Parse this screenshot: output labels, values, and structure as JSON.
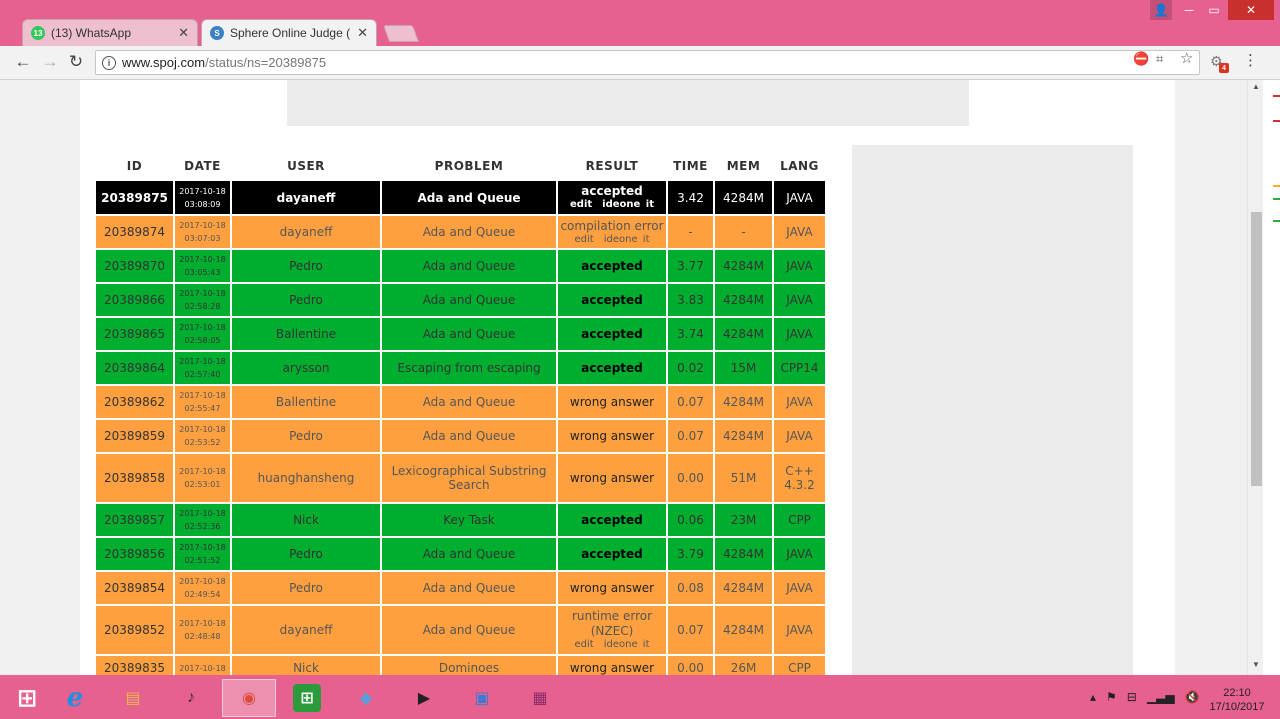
{
  "browser": {
    "tabs": [
      {
        "title": "(13) WhatsApp",
        "favicon": "whatsapp-icon",
        "favicon_text": "13",
        "favicon_color": "#34c759",
        "active": false
      },
      {
        "title": "Sphere Online Judge (SP",
        "favicon": "spoj-icon",
        "favicon_text": "S",
        "favicon_color": "#3a82c4",
        "active": true
      }
    ],
    "url_host": "www.spoj.com",
    "url_path": "/status/ns=20389875",
    "extension_badge": "4"
  },
  "table": {
    "headers": {
      "id": "ID",
      "date": "DATE",
      "user": "USER",
      "problem": "PROBLEM",
      "result": "RESULT",
      "time": "TIME",
      "mem": "MEM",
      "lang": "LANG"
    },
    "link_edit": "edit",
    "link_ideone": "ideone it",
    "rows": [
      {
        "id": "20389875",
        "date": "2017-10-18",
        "time_of_day": "03:08:09",
        "user": "dayaneff",
        "problem": "Ada and Queue",
        "result": "accepted",
        "links": true,
        "time": "3.42",
        "mem": "4284M",
        "lang": "JAVA",
        "color": "black"
      },
      {
        "id": "20389874",
        "date": "2017-10-18",
        "time_of_day": "03:07:03",
        "user": "dayaneff",
        "problem": "Ada and Queue",
        "result": "compilation error",
        "links": true,
        "time": "-",
        "mem": "-",
        "lang": "JAVA",
        "color": "orange"
      },
      {
        "id": "20389870",
        "date": "2017-10-18",
        "time_of_day": "03:05:43",
        "user": "Pedro",
        "problem": "Ada and Queue",
        "result": "accepted",
        "links": false,
        "time": "3.77",
        "mem": "4284M",
        "lang": "JAVA",
        "color": "green"
      },
      {
        "id": "20389866",
        "date": "2017-10-18",
        "time_of_day": "02:58:28",
        "user": "Pedro",
        "problem": "Ada and Queue",
        "result": "accepted",
        "links": false,
        "time": "3.83",
        "mem": "4284M",
        "lang": "JAVA",
        "color": "green"
      },
      {
        "id": "20389865",
        "date": "2017-10-18",
        "time_of_day": "02:58:05",
        "user": "Ballentine",
        "problem": "Ada and Queue",
        "result": "accepted",
        "links": false,
        "time": "3.74",
        "mem": "4284M",
        "lang": "JAVA",
        "color": "green"
      },
      {
        "id": "20389864",
        "date": "2017-10-18",
        "time_of_day": "02:57:40",
        "user": "arysson",
        "problem": "Escaping from escaping",
        "result": "accepted",
        "links": false,
        "time": "0.02",
        "mem": "15M",
        "lang": "CPP14",
        "color": "green"
      },
      {
        "id": "20389862",
        "date": "2017-10-18",
        "time_of_day": "02:55:47",
        "user": "Ballentine",
        "problem": "Ada and Queue",
        "result": "wrong answer",
        "links": false,
        "time": "0.07",
        "mem": "4284M",
        "lang": "JAVA",
        "color": "orange"
      },
      {
        "id": "20389859",
        "date": "2017-10-18",
        "time_of_day": "02:53:52",
        "user": "Pedro",
        "problem": "Ada and Queue",
        "result": "wrong answer",
        "links": false,
        "time": "0.07",
        "mem": "4284M",
        "lang": "JAVA",
        "color": "orange"
      },
      {
        "id": "20389858",
        "date": "2017-10-18",
        "time_of_day": "02:53:01",
        "user": "huanghansheng",
        "problem": "Lexicographical Substring Search",
        "result": "wrong answer",
        "links": false,
        "time": "0.00",
        "mem": "51M",
        "lang": "C++ 4.3.2",
        "color": "orange"
      },
      {
        "id": "20389857",
        "date": "2017-10-18",
        "time_of_day": "02:52:36",
        "user": "Nick",
        "problem": "Key Task",
        "result": "accepted",
        "links": false,
        "time": "0.06",
        "mem": "23M",
        "lang": "CPP",
        "color": "green"
      },
      {
        "id": "20389856",
        "date": "2017-10-18",
        "time_of_day": "02:51:52",
        "user": "Pedro",
        "problem": "Ada and Queue",
        "result": "accepted",
        "links": false,
        "time": "3.79",
        "mem": "4284M",
        "lang": "JAVA",
        "color": "green"
      },
      {
        "id": "20389854",
        "date": "2017-10-18",
        "time_of_day": "02:49:54",
        "user": "Pedro",
        "problem": "Ada and Queue",
        "result": "wrong answer",
        "links": false,
        "time": "0.08",
        "mem": "4284M",
        "lang": "JAVA",
        "color": "orange"
      },
      {
        "id": "20389852",
        "date": "2017-10-18",
        "time_of_day": "02:48:48",
        "user": "dayaneff",
        "problem": "Ada and Queue",
        "result": "runtime error (NZEC)",
        "links": true,
        "time": "0.07",
        "mem": "4284M",
        "lang": "JAVA",
        "color": "orange"
      },
      {
        "id": "20389835",
        "date": "2017-10-18",
        "time_of_day": "",
        "user": "Nick",
        "problem": "Dominoes",
        "result": "wrong answer",
        "links": false,
        "time": "0.00",
        "mem": "26M",
        "lang": "CPP",
        "color": "orange"
      }
    ]
  },
  "taskbar": {
    "items": [
      {
        "name": "start-button",
        "glyph": "⊞",
        "color": "#ffffff",
        "bg": "transparent"
      },
      {
        "name": "internet-explorer-icon",
        "glyph": "e",
        "color": "#1e8fe0",
        "bg": "transparent"
      },
      {
        "name": "file-explorer-icon",
        "glyph": "▤",
        "color": "#e8b848",
        "bg": "transparent"
      },
      {
        "name": "media-player-icon",
        "glyph": "♪",
        "color": "#333333",
        "bg": "transparent"
      },
      {
        "name": "chrome-icon",
        "glyph": "◉",
        "color": "#dd4b39",
        "bg": "transparent"
      },
      {
        "name": "store-icon",
        "glyph": "⊞",
        "color": "#ffffff",
        "bg": "#2a9a3a"
      },
      {
        "name": "notes-icon",
        "glyph": "◆",
        "color": "#5aa0d8",
        "bg": "transparent"
      },
      {
        "name": "video-editor-icon",
        "glyph": "▶",
        "color": "#222222",
        "bg": "transparent"
      },
      {
        "name": "virtualbox-icon",
        "glyph": "▣",
        "color": "#3a7bd5",
        "bg": "transparent"
      },
      {
        "name": "winrar-icon",
        "glyph": "▦",
        "color": "#8a2b6a",
        "bg": "transparent"
      }
    ],
    "clock_time": "22:10",
    "clock_date": "17/10/2017"
  }
}
